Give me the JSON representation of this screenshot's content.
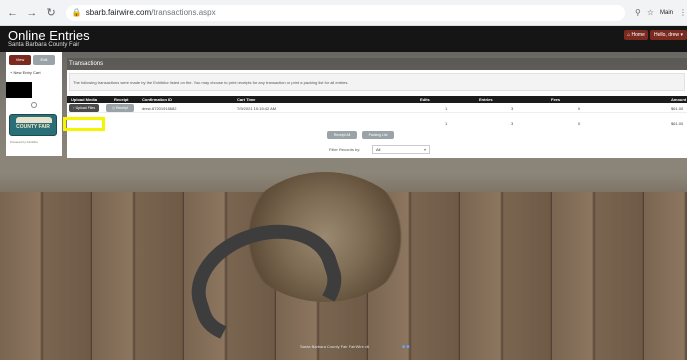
{
  "browser": {
    "url_host": "sbarb.fairwire.com",
    "url_path": "/transactions.aspx",
    "back_icon": "back-arrow-icon",
    "forward_icon": "forward-arrow-icon",
    "reload_icon": "reload-icon",
    "profile_label": "Main"
  },
  "header": {
    "title": "Online Entries",
    "subtitle": "Santa Barbara County Fair",
    "home_label": "Home",
    "user_label": "Hello, drew"
  },
  "sidebar": {
    "btn1": "View",
    "btn2": "Edit",
    "new_entry": "New Entry Cart",
    "logo_text": "COUNTY FAIR",
    "powered": "Powered by FairWire"
  },
  "panel": {
    "title": "Transactions",
    "notice": "The following transactions were made by the Exhibitor listed on the. You may choose to print receipts for any transaction or print a packing list for all entries."
  },
  "table": {
    "headers": {
      "upload_media": "Upload Media",
      "receipt": "Receipt",
      "confirmation": "Confirmation ID",
      "cart_time": "Cart Time",
      "entries": "Entries",
      "fees": "Fees",
      "amount": "Amount"
    },
    "row": {
      "upload_label": "Upload Files",
      "receipt_label": "Receipt",
      "confirmation": "drew-67201915682",
      "cart_time": "7/9/2021 10:15:42 AM",
      "edits": "1",
      "entries": "3",
      "fees": "0",
      "amount": "$61.00"
    },
    "totals": {
      "edits": "1",
      "entries": "3",
      "fees": "0",
      "amount": "$61.00"
    }
  },
  "actions": {
    "receipt_all": "Receipt All",
    "packing_list": "Packing List"
  },
  "filter": {
    "label": "Filter Records by:",
    "value": "All"
  },
  "footer": {
    "text": "Santa Barbara County Fair FairWire v6"
  }
}
